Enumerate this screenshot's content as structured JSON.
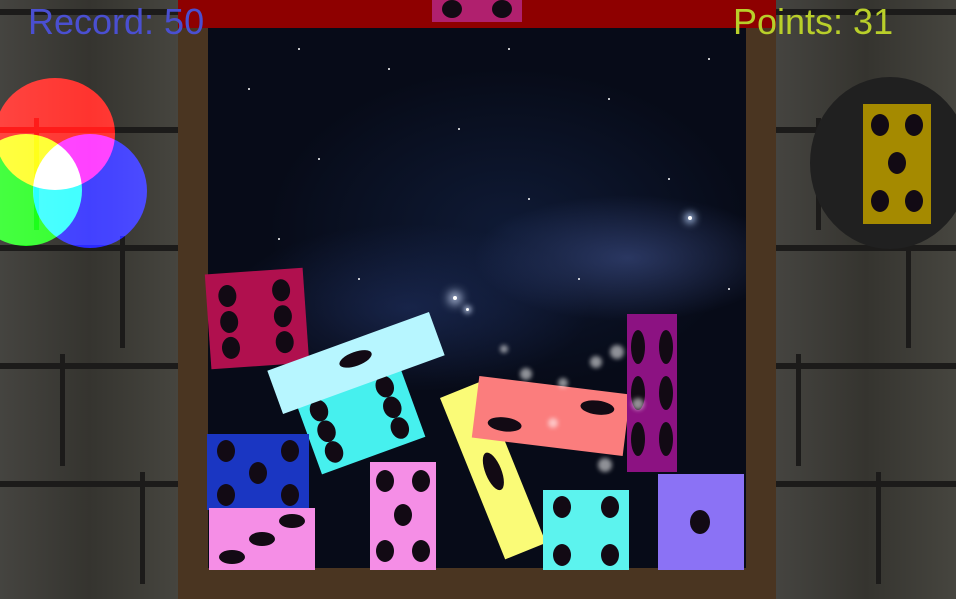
{
  "hud": {
    "record_label": "Record: 50",
    "points_label": "Points: 31"
  },
  "colors": {
    "record_text": "#4a4fd1",
    "points_text": "#b9cf2a",
    "top_bar": "#8e0000",
    "frame": "#4a3521"
  },
  "color_wheel": {
    "circles": [
      "red",
      "green",
      "blue"
    ]
  },
  "next_piece": {
    "color": "#a58a00",
    "pips": 5
  },
  "falling_piece": {
    "color": "#b0206e",
    "pips": 2
  },
  "dice": [
    {
      "name": "die-magenta-six",
      "color": "#b0104e",
      "pips": 6
    },
    {
      "name": "die-lightcyan-one",
      "color": "#b7f6ff",
      "pips": 1
    },
    {
      "name": "die-cyan-six",
      "color": "#46f0ee",
      "pips": 6
    },
    {
      "name": "die-blue-five",
      "color": "#1a36c2",
      "pips": 5
    },
    {
      "name": "die-pink-three",
      "color": "#f58ee6",
      "pips": 3
    },
    {
      "name": "die-pink-five",
      "color": "#f58ee6",
      "pips": 5
    },
    {
      "name": "die-yellow-one",
      "color": "#fafb77",
      "pips": 1
    },
    {
      "name": "die-salmon-two",
      "color": "#fb7d7d",
      "pips": 2
    },
    {
      "name": "die-purple-six",
      "color": "#8c1282",
      "pips": 6
    },
    {
      "name": "die-cyan-four",
      "color": "#5cf3ee",
      "pips": 4
    },
    {
      "name": "die-violet-one",
      "color": "#8b72f5",
      "pips": 1
    }
  ]
}
